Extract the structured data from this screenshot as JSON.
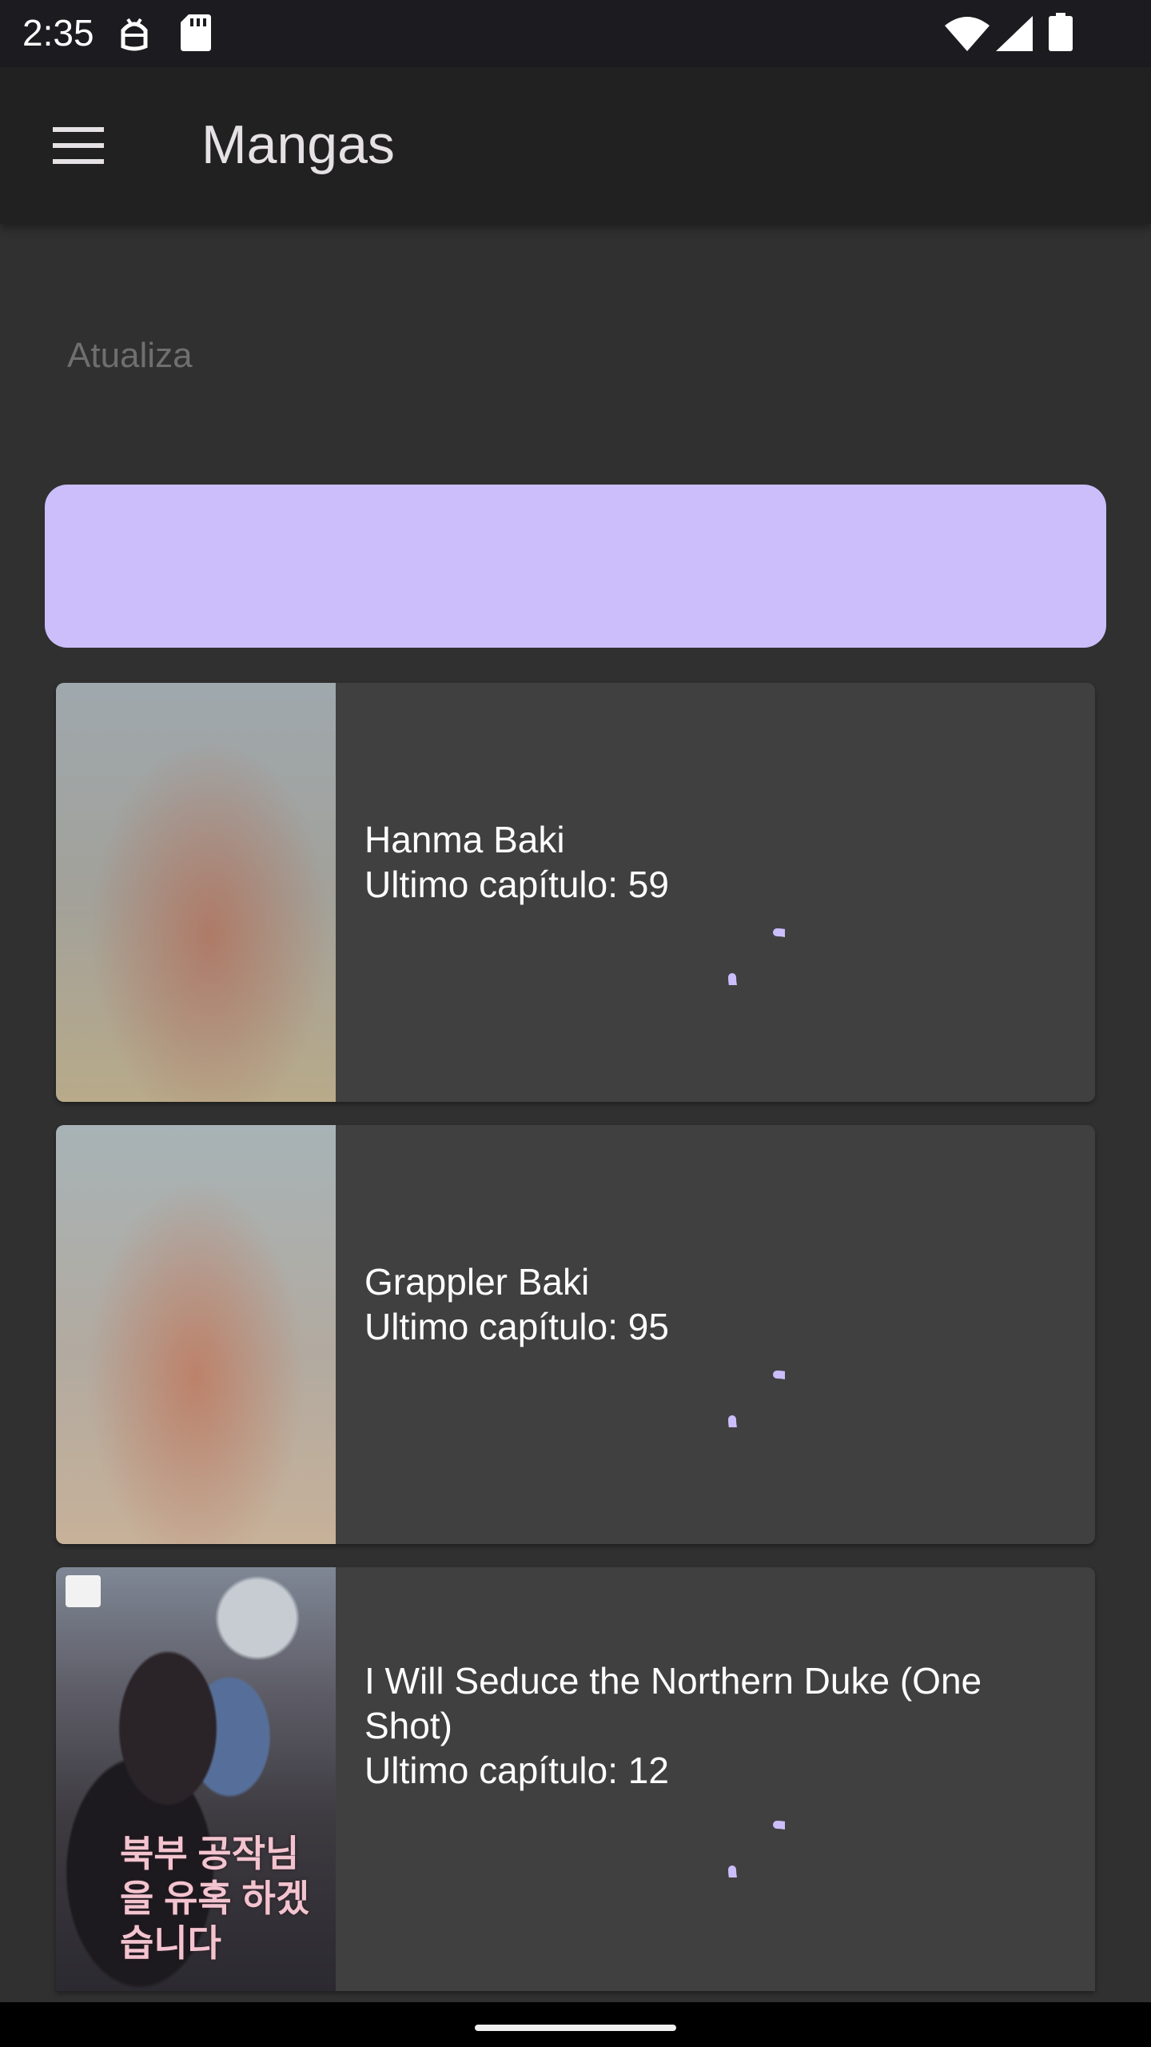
{
  "status_bar": {
    "time": "2:35",
    "icons": [
      "android-debug-icon",
      "sd-card-icon",
      "wifi-icon",
      "cell-signal-icon",
      "battery-icon"
    ]
  },
  "app_bar": {
    "title": "Mangas",
    "menu_icon": "hamburger-menu-icon"
  },
  "update_field": {
    "label": "Atualiza"
  },
  "primary_button": {
    "label": "",
    "color": "#cbbefb"
  },
  "mangas": [
    {
      "title": "Hanma Baki",
      "last_chapter": "Ultimo capítulo: 59"
    },
    {
      "title": "Grappler Baki",
      "last_chapter": "Ultimo capítulo: 95"
    },
    {
      "title": "I Will Seduce the Northern Duke (One Shot)",
      "last_chapter": "Ultimo capítulo: 12",
      "cover_text": "북부 공작님을 유혹 하겠습니다"
    }
  ],
  "colors": {
    "accent": "#cbbefb",
    "background": "#303030",
    "card": "#404040",
    "app_bar": "#212121"
  }
}
